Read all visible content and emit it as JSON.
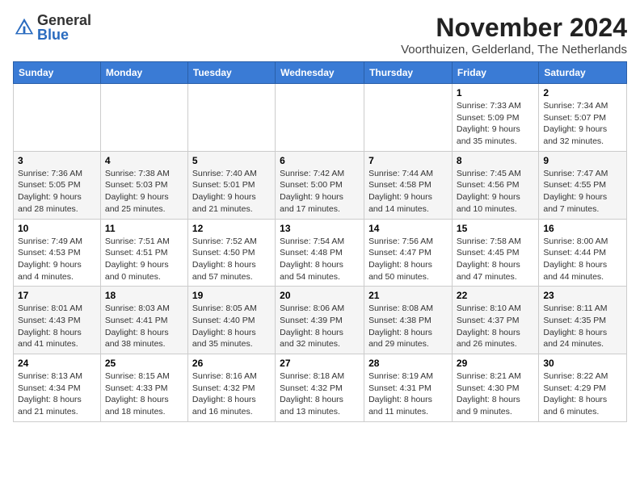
{
  "header": {
    "logo_general": "General",
    "logo_blue": "Blue",
    "title": "November 2024",
    "subtitle": "Voorthuizen, Gelderland, The Netherlands"
  },
  "calendar": {
    "days_of_week": [
      "Sunday",
      "Monday",
      "Tuesday",
      "Wednesday",
      "Thursday",
      "Friday",
      "Saturday"
    ],
    "weeks": [
      [
        {
          "day": "",
          "detail": ""
        },
        {
          "day": "",
          "detail": ""
        },
        {
          "day": "",
          "detail": ""
        },
        {
          "day": "",
          "detail": ""
        },
        {
          "day": "",
          "detail": ""
        },
        {
          "day": "1",
          "detail": "Sunrise: 7:33 AM\nSunset: 5:09 PM\nDaylight: 9 hours and 35 minutes."
        },
        {
          "day": "2",
          "detail": "Sunrise: 7:34 AM\nSunset: 5:07 PM\nDaylight: 9 hours and 32 minutes."
        }
      ],
      [
        {
          "day": "3",
          "detail": "Sunrise: 7:36 AM\nSunset: 5:05 PM\nDaylight: 9 hours and 28 minutes."
        },
        {
          "day": "4",
          "detail": "Sunrise: 7:38 AM\nSunset: 5:03 PM\nDaylight: 9 hours and 25 minutes."
        },
        {
          "day": "5",
          "detail": "Sunrise: 7:40 AM\nSunset: 5:01 PM\nDaylight: 9 hours and 21 minutes."
        },
        {
          "day": "6",
          "detail": "Sunrise: 7:42 AM\nSunset: 5:00 PM\nDaylight: 9 hours and 17 minutes."
        },
        {
          "day": "7",
          "detail": "Sunrise: 7:44 AM\nSunset: 4:58 PM\nDaylight: 9 hours and 14 minutes."
        },
        {
          "day": "8",
          "detail": "Sunrise: 7:45 AM\nSunset: 4:56 PM\nDaylight: 9 hours and 10 minutes."
        },
        {
          "day": "9",
          "detail": "Sunrise: 7:47 AM\nSunset: 4:55 PM\nDaylight: 9 hours and 7 minutes."
        }
      ],
      [
        {
          "day": "10",
          "detail": "Sunrise: 7:49 AM\nSunset: 4:53 PM\nDaylight: 9 hours and 4 minutes."
        },
        {
          "day": "11",
          "detail": "Sunrise: 7:51 AM\nSunset: 4:51 PM\nDaylight: 9 hours and 0 minutes."
        },
        {
          "day": "12",
          "detail": "Sunrise: 7:52 AM\nSunset: 4:50 PM\nDaylight: 8 hours and 57 minutes."
        },
        {
          "day": "13",
          "detail": "Sunrise: 7:54 AM\nSunset: 4:48 PM\nDaylight: 8 hours and 54 minutes."
        },
        {
          "day": "14",
          "detail": "Sunrise: 7:56 AM\nSunset: 4:47 PM\nDaylight: 8 hours and 50 minutes."
        },
        {
          "day": "15",
          "detail": "Sunrise: 7:58 AM\nSunset: 4:45 PM\nDaylight: 8 hours and 47 minutes."
        },
        {
          "day": "16",
          "detail": "Sunrise: 8:00 AM\nSunset: 4:44 PM\nDaylight: 8 hours and 44 minutes."
        }
      ],
      [
        {
          "day": "17",
          "detail": "Sunrise: 8:01 AM\nSunset: 4:43 PM\nDaylight: 8 hours and 41 minutes."
        },
        {
          "day": "18",
          "detail": "Sunrise: 8:03 AM\nSunset: 4:41 PM\nDaylight: 8 hours and 38 minutes."
        },
        {
          "day": "19",
          "detail": "Sunrise: 8:05 AM\nSunset: 4:40 PM\nDaylight: 8 hours and 35 minutes."
        },
        {
          "day": "20",
          "detail": "Sunrise: 8:06 AM\nSunset: 4:39 PM\nDaylight: 8 hours and 32 minutes."
        },
        {
          "day": "21",
          "detail": "Sunrise: 8:08 AM\nSunset: 4:38 PM\nDaylight: 8 hours and 29 minutes."
        },
        {
          "day": "22",
          "detail": "Sunrise: 8:10 AM\nSunset: 4:37 PM\nDaylight: 8 hours and 26 minutes."
        },
        {
          "day": "23",
          "detail": "Sunrise: 8:11 AM\nSunset: 4:35 PM\nDaylight: 8 hours and 24 minutes."
        }
      ],
      [
        {
          "day": "24",
          "detail": "Sunrise: 8:13 AM\nSunset: 4:34 PM\nDaylight: 8 hours and 21 minutes."
        },
        {
          "day": "25",
          "detail": "Sunrise: 8:15 AM\nSunset: 4:33 PM\nDaylight: 8 hours and 18 minutes."
        },
        {
          "day": "26",
          "detail": "Sunrise: 8:16 AM\nSunset: 4:32 PM\nDaylight: 8 hours and 16 minutes."
        },
        {
          "day": "27",
          "detail": "Sunrise: 8:18 AM\nSunset: 4:32 PM\nDaylight: 8 hours and 13 minutes."
        },
        {
          "day": "28",
          "detail": "Sunrise: 8:19 AM\nSunset: 4:31 PM\nDaylight: 8 hours and 11 minutes."
        },
        {
          "day": "29",
          "detail": "Sunrise: 8:21 AM\nSunset: 4:30 PM\nDaylight: 8 hours and 9 minutes."
        },
        {
          "day": "30",
          "detail": "Sunrise: 8:22 AM\nSunset: 4:29 PM\nDaylight: 8 hours and 6 minutes."
        }
      ]
    ]
  }
}
